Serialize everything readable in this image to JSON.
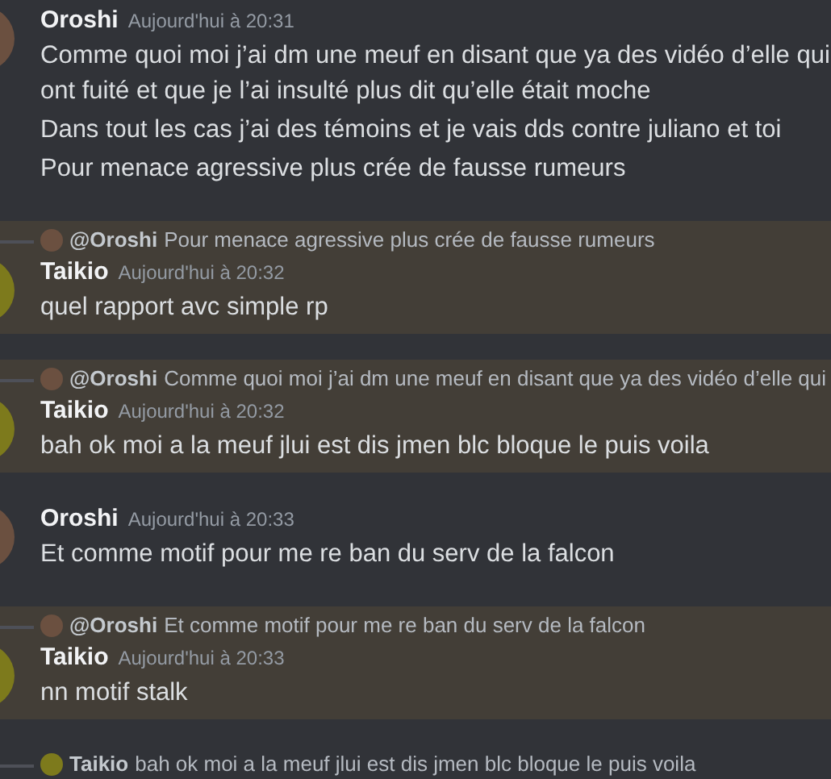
{
  "messages": [
    {
      "highlighted": false,
      "author": {
        "name": "Oroshi",
        "color": "#6b5040"
      },
      "timestamp": "Aujourd'hui à 20:31",
      "lines": [
        "Comme quoi moi j’ai dm une meuf en disant que ya des vidéo d’elle qui ont fuité et que je l’ai insulté plus dit qu’elle était moche",
        "Dans tout les cas j’ai des témoins et je vais dds contre juliano et toi",
        "Pour menace agressive plus crée de fausse rumeurs"
      ]
    },
    {
      "highlighted": true,
      "reply": {
        "author": "@Oroshi",
        "color": "#6b5040",
        "text": "Pour menace agressive plus crée de fausse rumeurs"
      },
      "author": {
        "name": "Taikio",
        "color": "#7d7a1c"
      },
      "timestamp": "Aujourd'hui à 20:32",
      "lines": [
        "quel rapport avc simple rp"
      ]
    },
    {
      "highlighted": true,
      "reply": {
        "author": "@Oroshi",
        "color": "#6b5040",
        "text": "Comme quoi moi j’ai dm une meuf en disant que ya des vidéo d’elle qui"
      },
      "author": {
        "name": "Taikio",
        "color": "#7d7a1c"
      },
      "timestamp": "Aujourd'hui à 20:32",
      "lines": [
        "bah ok moi a la meuf jlui est dis jmen blc bloque le puis voila"
      ]
    },
    {
      "highlighted": false,
      "author": {
        "name": "Oroshi",
        "color": "#6b5040"
      },
      "timestamp": "Aujourd'hui à 20:33",
      "lines": [
        "Et comme motif pour me re ban du serv de la falcon"
      ]
    },
    {
      "highlighted": true,
      "reply": {
        "author": "@Oroshi",
        "color": "#6b5040",
        "text": "Et comme motif pour me re ban du serv de la falcon"
      },
      "author": {
        "name": "Taikio",
        "color": "#7d7a1c"
      },
      "timestamp": "Aujourd'hui à 20:33",
      "lines": [
        "nn motif stalk"
      ]
    },
    {
      "highlighted": false,
      "reply": {
        "author": "Taikio",
        "color": "#7d7a1c",
        "text": "bah ok moi a la meuf jlui est dis jmen blc bloque le puis voila"
      }
    }
  ]
}
